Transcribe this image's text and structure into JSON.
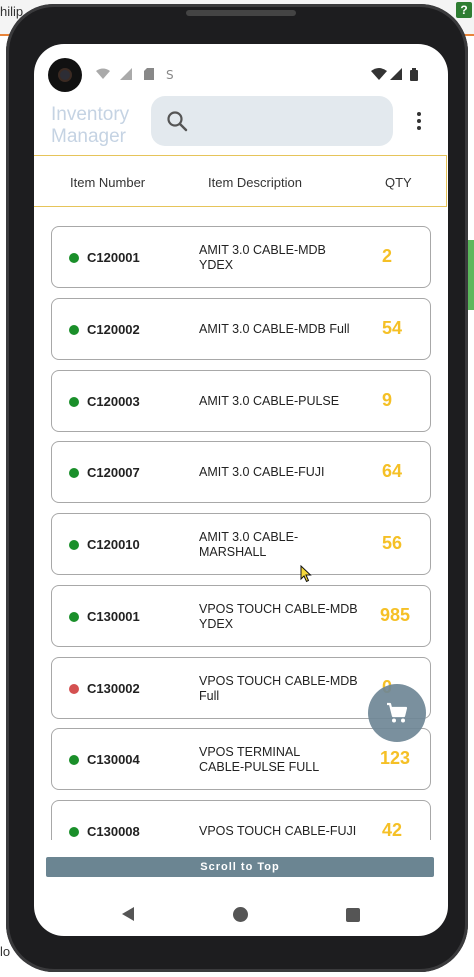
{
  "desktop": {
    "top_left_text": "hilip",
    "bottom_left_text": "lo",
    "help_label": "?",
    "accent_color": "#e8843a"
  },
  "status_bar": {
    "icons_left": [
      "wifi-question-icon",
      "signal-question-icon",
      "sd-card-icon",
      "s-icon"
    ],
    "icons_right": [
      "wifi-icon",
      "signal-icon",
      "battery-icon"
    ]
  },
  "app": {
    "title": "Inventory Manager",
    "search": {
      "placeholder": ""
    },
    "menu_icon": "more-vert-icon"
  },
  "columns": {
    "item_number": "Item Number",
    "item_description": "Item Description",
    "qty": "QTY"
  },
  "items": [
    {
      "number": "C120001",
      "description": "AMIT 3.0 CABLE-MDB YDEX",
      "qty": "2",
      "status_color": "#1a8f2a"
    },
    {
      "number": "C120002",
      "description": "AMIT 3.0 CABLE-MDB Full",
      "qty": "54",
      "status_color": "#1a8f2a"
    },
    {
      "number": "C120003",
      "description": "AMIT 3.0 CABLE-PULSE",
      "qty": "9",
      "status_color": "#1a8f2a"
    },
    {
      "number": "C120007",
      "description": "AMIT 3.0 CABLE-FUJI",
      "qty": "64",
      "status_color": "#1a8f2a"
    },
    {
      "number": "C120010",
      "description": "AMIT 3.0 CABLE-MARSHALL",
      "qty": "56",
      "status_color": "#1a8f2a"
    },
    {
      "number": "C130001",
      "description": "VPOS TOUCH CABLE-MDB YDEX",
      "qty": "985",
      "status_color": "#1a8f2a"
    },
    {
      "number": "C130002",
      "description": "VPOS TOUCH CABLE-MDB Full",
      "qty": "0",
      "status_color": "#d45050"
    },
    {
      "number": "C130004",
      "description": "VPOS TERMINAL CABLE-PULSE FULL",
      "qty": "123",
      "status_color": "#1a8f2a"
    },
    {
      "number": "C130008",
      "description": "VPOS TOUCH CABLE-FUJI",
      "qty": "42",
      "status_color": "#1a8f2a"
    }
  ],
  "fab": {
    "icon": "cart-icon"
  },
  "scroll_top": {
    "label": "Scroll to Top"
  },
  "nav": {
    "back": "back-icon",
    "home": "home-icon",
    "recents": "recents-icon"
  },
  "colors": {
    "qty": "#f5c026",
    "in_stock": "#1a8f2a",
    "out_of_stock": "#d45050",
    "header_border": "#e6c45a"
  }
}
